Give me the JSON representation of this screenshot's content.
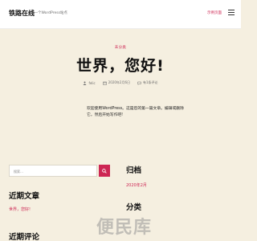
{
  "header": {
    "site_title": "铁路在线",
    "tagline": "又一个WordPress站点",
    "link_label": "示例页面"
  },
  "post": {
    "category": "未分类",
    "title": "世界，您好!",
    "author": "felic",
    "date": "2020年2月6日",
    "comments": "有1条评论",
    "body": "欢迎使用WordPress。这是您的第一篇文章。编辑或删除它，然后开始写作吧!"
  },
  "widgets": {
    "search_placeholder": "搜索…",
    "recent_posts_heading": "近期文章",
    "recent_post_link": "世界，您好!",
    "recent_comments_heading": "近期评论",
    "archive_heading": "归档",
    "archive_link": "2020年2月",
    "categories_heading": "分类"
  },
  "watermark": "便民库",
  "colors": {
    "accent": "#cd2653",
    "background": "#f5efe0"
  }
}
